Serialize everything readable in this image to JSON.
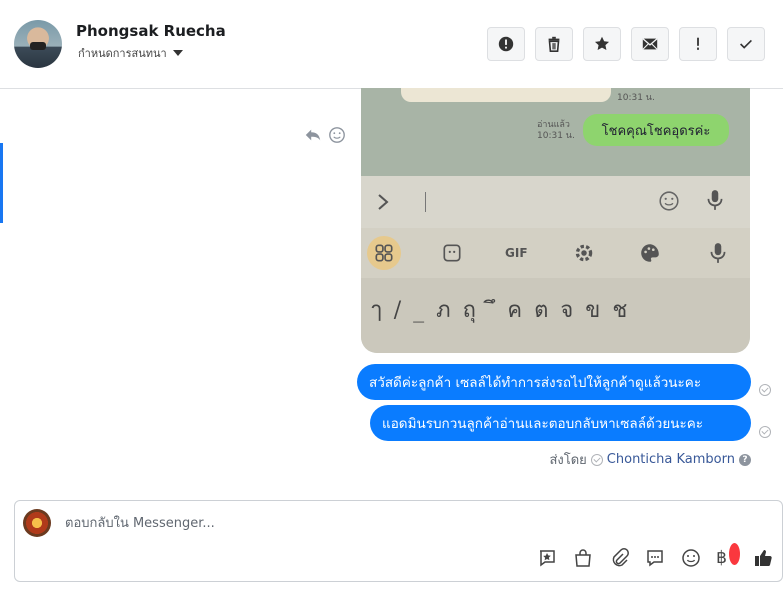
{
  "header": {
    "contact_name": "Phongsak Ruecha",
    "assign_label": "กำหนดการสนทนา",
    "toolbar": [
      {
        "name": "report-button",
        "icon": "alert-circle-icon"
      },
      {
        "name": "delete-button",
        "icon": "trash-icon"
      },
      {
        "name": "star-button",
        "icon": "star-icon"
      },
      {
        "name": "mark-unread-button",
        "icon": "envelope-icon"
      },
      {
        "name": "follow-up-button",
        "icon": "exclamation-icon"
      },
      {
        "name": "mark-done-button",
        "icon": "check-icon"
      }
    ]
  },
  "photo": {
    "time_top": "10:31 น.",
    "read_label": "อ่านแล้ว",
    "read_time": "10:31 น.",
    "green_bubble": "โชคคุณโชคอุดรค่ะ",
    "gif_label": "GIF",
    "key_row": "ๅ/_ภถุ ึคตจขช"
  },
  "messages": [
    {
      "text": "สวัสดีค่ะลูกค้า เซลล์ได้ทำการส่งรถไปให้ลูกค้าดูแล้วนะคะ"
    },
    {
      "text": "แอดมินรบกวนลูกค้าอ่านและตอบกลับหาเซลล์ด้วยนะคะ"
    }
  ],
  "sent_by": {
    "label": "ส่งโดย",
    "agent": "Chonticha Kamborn"
  },
  "composer": {
    "placeholder": "ตอบกลับใน Messenger...",
    "baht": "฿"
  },
  "colors": {
    "accent": "#0a7cff",
    "like": "#333333",
    "badge": "#fa383e"
  }
}
